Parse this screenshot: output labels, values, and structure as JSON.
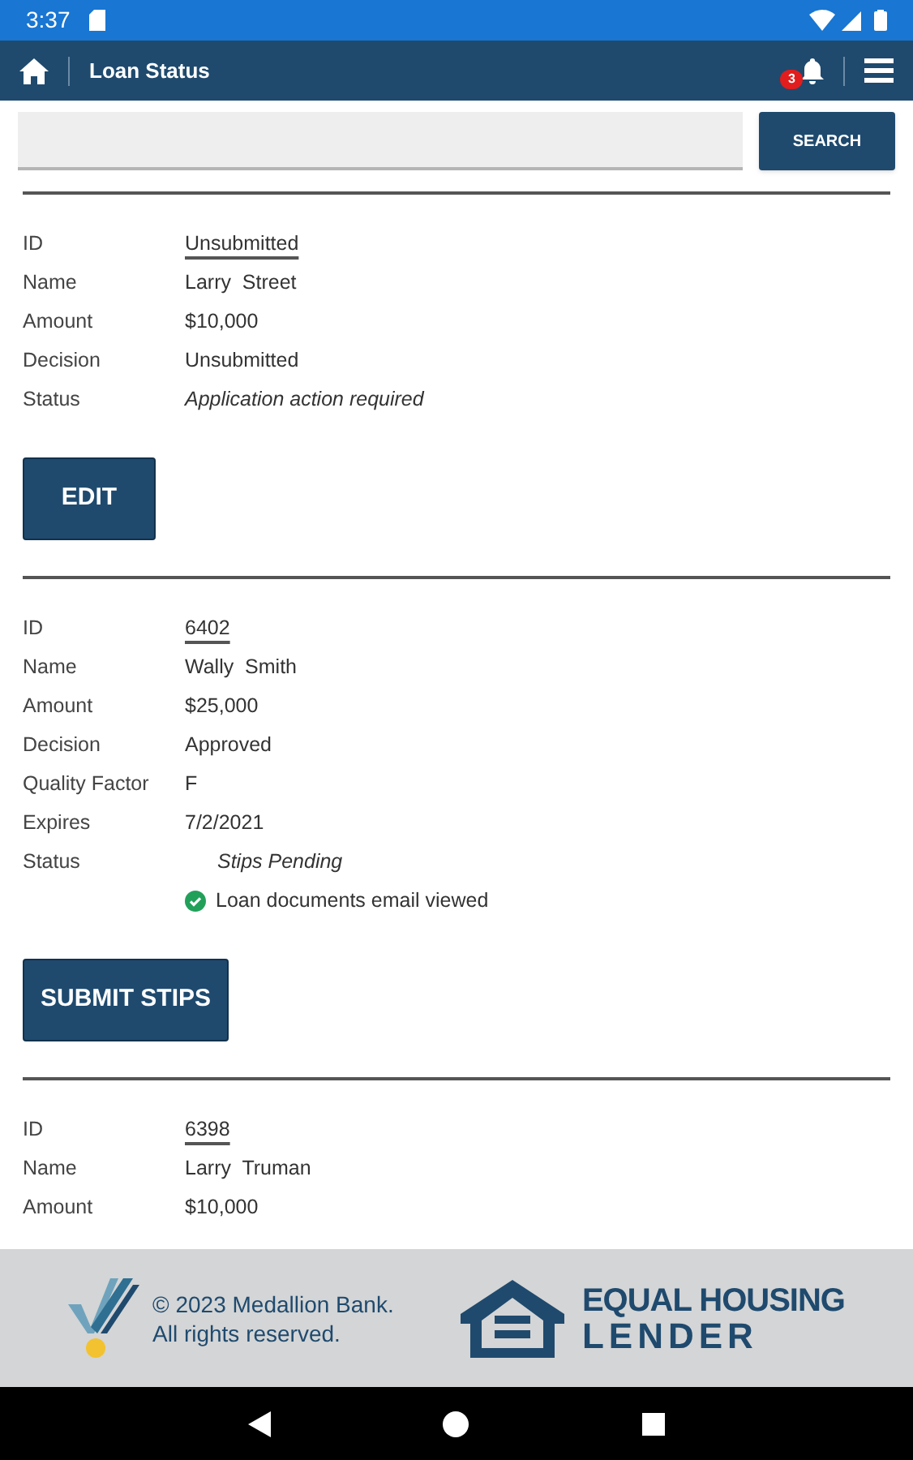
{
  "status_bar": {
    "time": "3:37"
  },
  "app_bar": {
    "title": "Loan Status",
    "notification_count": "3"
  },
  "search": {
    "button": "SEARCH"
  },
  "loans": [
    {
      "fields": [
        {
          "label": "ID",
          "value": "Unsubmitted",
          "kind": "link"
        },
        {
          "label": "Name",
          "value": "Larry  Street",
          "kind": "plain"
        },
        {
          "label": "Amount",
          "value": "$10,000",
          "kind": "plain"
        },
        {
          "label": "Decision",
          "value": "Unsubmitted",
          "kind": "plain"
        },
        {
          "label": "Status",
          "value": "Application action required",
          "kind": "italic"
        }
      ],
      "button": "EDIT"
    },
    {
      "fields": [
        {
          "label": "ID",
          "value": "6402",
          "kind": "link"
        },
        {
          "label": "Name",
          "value": "Wally  Smith",
          "kind": "plain"
        },
        {
          "label": "Amount",
          "value": "$25,000",
          "kind": "plain"
        },
        {
          "label": "Decision",
          "value": "Approved",
          "kind": "plain"
        },
        {
          "label": "Quality Factor",
          "value": "F",
          "kind": "plain"
        },
        {
          "label": "Expires",
          "value": "7/2/2021",
          "kind": "plain"
        },
        {
          "label": "Status",
          "value": "Stips Pending",
          "kind": "italic"
        }
      ],
      "notes": [
        {
          "text": "Loan documents email viewed",
          "checked": true
        }
      ],
      "button": "SUBMIT STIPS"
    },
    {
      "fields": [
        {
          "label": "ID",
          "value": "6398",
          "kind": "link"
        },
        {
          "label": "Name",
          "value": "Larry  Truman",
          "kind": "plain"
        },
        {
          "label": "Amount",
          "value": "$10,000",
          "kind": "plain"
        }
      ]
    }
  ],
  "footer": {
    "copyright": "© 2023 Medallion Bank.",
    "rights": "All rights reserved.",
    "lender_line1": "EQUAL HOUSING",
    "lender_line2": "LENDER"
  }
}
